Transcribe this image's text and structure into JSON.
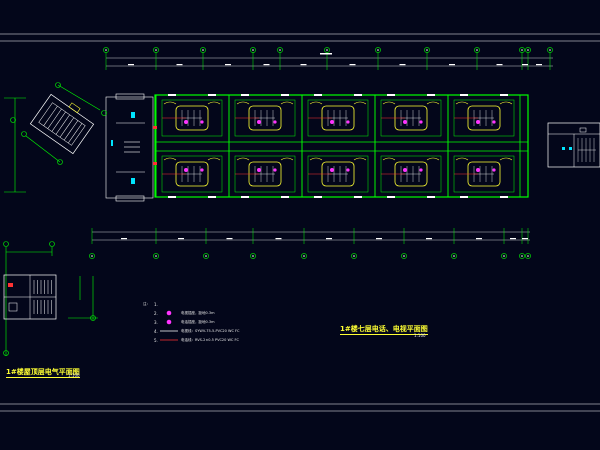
{
  "drawing": {
    "main_title": "1#楼七层电话、电视平面图",
    "main_scale": "1:100",
    "detail_title": "1#楼屋顶层电气平面图",
    "detail_scale": "1:100"
  },
  "legend": {
    "mark": "注：",
    "items": [
      {
        "index": "1.",
        "symbol": "none",
        "text": ""
      },
      {
        "index": "2.",
        "symbol": "magenta-dot",
        "text": "电视插座，距地0.3m"
      },
      {
        "index": "3.",
        "symbol": "magenta-dot",
        "text": "电话插座，距地0.3m"
      },
      {
        "index": "4.",
        "symbol": "white-line",
        "text": "电视线：SYWV-75-5-PVC20 WC FC"
      },
      {
        "index": "5.",
        "symbol": "red-line",
        "text": "电话线：RVS-2×0.5 PVC20 WC FC"
      }
    ]
  },
  "colors": {
    "background": "#03061a",
    "wall": "#00ff00",
    "axis": "#00ff00",
    "door": "#ffff33",
    "outlet": "#ff33ff",
    "wiring": "#ff3333",
    "annotation": "#ffffff",
    "title": "#ffff33"
  }
}
